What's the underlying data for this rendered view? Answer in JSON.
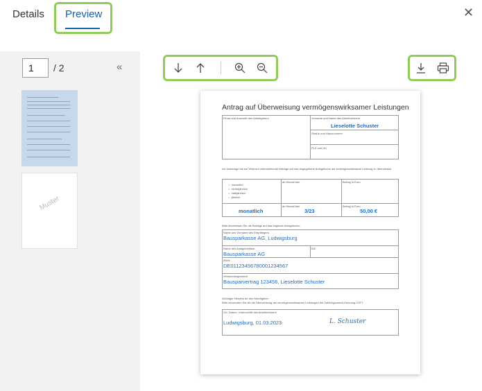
{
  "tabs": {
    "details": "Details",
    "preview": "Preview"
  },
  "pager": {
    "current": "1",
    "total": "/ 2"
  },
  "thumbnail_watermark": "Muster",
  "form": {
    "title": "Antrag auf Überweisung vermögenswirksamer Leistungen",
    "employer_label": "Firma und Anschrift des Arbeitgebers",
    "employee_name_label": "Vorname und Name des Arbeitnehmers",
    "employee_name": "Lieselotte Schuster",
    "street_label": "Straße und Hausnummer",
    "zip_label": "PLZ und Ort",
    "intro_text": "Ich beantrage bis auf Widerruf untenstehende Beträge auf das angegebene Anlagekonto als vermögenswirksame Leistung zu überweisen.",
    "freq_options": [
      "monatlich",
      "vierteljährlich",
      "halbjährlich",
      "jährlich"
    ],
    "from_month_label": "ab Monat/Jahr",
    "amount_label": "Betrag in Euro",
    "frequency": "monatlich",
    "from_month_label2": "ab Monat/Jahr",
    "from_month": "3/23",
    "amount_label2": "Betrag in Euro",
    "amount": "50,00 €",
    "transfer_text": "Bitte überweisen Sie die Beträge auf das folgende Anlagekonto:",
    "recipient_label": "Name und Vorname des Empfängers",
    "recipient": "Bausparkasse AG, Ludwigsburg",
    "institute_label": "Name des Anlageinstituts",
    "bic_label": "BIC",
    "institute": "Bausparkasse AG",
    "iban_label": "IBAN",
    "iban": "DE01123456780001234567",
    "purpose_label": "Verwendungszweck",
    "purpose": "Bausparvertrag 123456, Lieselotte Schuster",
    "hint_heading": "Wichtiger Hinweis für den Arbeitgeber:",
    "hint_text": "Bitte verwenden Sie für die Überweisung der vermögenswirksamen Leistungen die Zahlungszweck-Kennung C0FT.",
    "sign_label": "Ort, Datum, Unterschrift des Arbeitnehmers",
    "sign_place_date": "Ludwigsburg, 01.03.2023",
    "signature": "L. Schuster"
  }
}
